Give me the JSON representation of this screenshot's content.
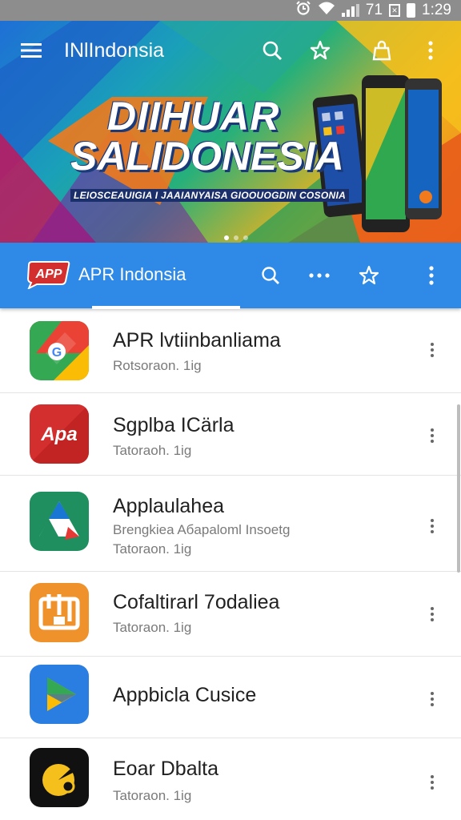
{
  "status_bar": {
    "time": "1:29",
    "indicator_text": "71",
    "icons": [
      "alarm-icon",
      "wifi-icon",
      "signal-icon",
      "sim-icon",
      "battery-icon"
    ]
  },
  "toolbar": {
    "title": "INlIndonsia",
    "icons": [
      "menu-icon",
      "search-icon",
      "star-icon",
      "bag-icon",
      "more-vert-icon"
    ]
  },
  "banner": {
    "headline_1": "DIIHUAR",
    "headline_2": "SALIDONESIA",
    "subtitle": "LEIOSCEAUIGIA I JAAIANYAISA GIOOUOGDIN COSONIA",
    "pager_active": 1,
    "pager_count": 3
  },
  "appbar": {
    "logo_text": "APP",
    "name": "APR Indonsia",
    "icons": [
      "search-icon",
      "more-horiz-icon",
      "star-icon",
      "more-vert-icon"
    ],
    "color": "#2e8ae6"
  },
  "apps": [
    {
      "name": "APR lvtiinbanliama",
      "subtitle": "",
      "meta": "Rotsoraon. 1ig",
      "icon": "google-icon",
      "icon_color": "#34a853"
    },
    {
      "name": "Sgplba ICärla",
      "subtitle": "",
      "meta": "Tatoraoh. 1ig",
      "icon": "apa-icon",
      "icon_color": "#d32f2f",
      "icon_text": "Apa"
    },
    {
      "name": "Applaulahea",
      "subtitle": "Brengkiea Aбapaloml Insoetg",
      "meta": "Tatoraon. 1ig",
      "icon": "drive-icon",
      "icon_color": "#1f8f5f"
    },
    {
      "name": "Cofaltirarl 7odaliea",
      "subtitle": "",
      "meta": "Tatoraon. 1ig",
      "icon": "tile-icon",
      "icon_color": "#f0922b"
    },
    {
      "name": "Appbicla Cusice",
      "subtitle": "",
      "meta": "",
      "icon": "play-arrow-icon",
      "icon_color": "#2a7de1"
    },
    {
      "name": "Eoar Dbalta",
      "subtitle": "",
      "meta": "Tatoraon. 1ig",
      "icon": "disc-icon",
      "icon_color": "#111111"
    }
  ]
}
